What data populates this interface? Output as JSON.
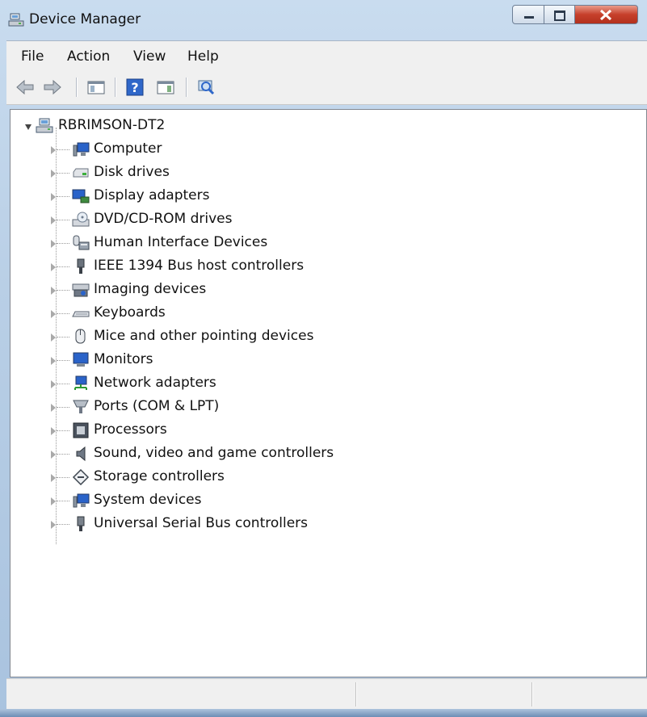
{
  "window": {
    "title": "Device Manager",
    "buttons": [
      "minimize",
      "maximize",
      "close"
    ]
  },
  "menu": {
    "items": [
      "File",
      "Action",
      "View",
      "Help"
    ]
  },
  "toolbar": {
    "buttons": [
      "back-icon",
      "forward-icon",
      "show-hide-console-tree-icon",
      "help-icon",
      "show-hide-action-pane-icon",
      "scan-hardware-icon"
    ]
  },
  "tree": {
    "root": {
      "label": "RBRIMSON-DT2",
      "icon": "computer-network-icon",
      "expanded": true
    },
    "items": [
      {
        "label": "Computer",
        "icon": "computer-icon"
      },
      {
        "label": "Disk drives",
        "icon": "disk-drive-icon"
      },
      {
        "label": "Display adapters",
        "icon": "display-adapter-icon"
      },
      {
        "label": "DVD/CD-ROM drives",
        "icon": "dvd-drive-icon"
      },
      {
        "label": "Human Interface Devices",
        "icon": "hid-icon"
      },
      {
        "label": "IEEE 1394 Bus host controllers",
        "icon": "ieee1394-icon"
      },
      {
        "label": "Imaging devices",
        "icon": "camera-icon"
      },
      {
        "label": "Keyboards",
        "icon": "keyboard-icon"
      },
      {
        "label": "Mice and other pointing devices",
        "icon": "mouse-icon"
      },
      {
        "label": "Monitors",
        "icon": "monitor-icon"
      },
      {
        "label": "Network adapters",
        "icon": "network-adapter-icon"
      },
      {
        "label": "Ports (COM & LPT)",
        "icon": "port-icon"
      },
      {
        "label": "Processors",
        "icon": "processor-icon"
      },
      {
        "label": "Sound, video and game controllers",
        "icon": "speaker-icon"
      },
      {
        "label": "Storage controllers",
        "icon": "storage-controller-icon"
      },
      {
        "label": "System devices",
        "icon": "system-devices-icon"
      },
      {
        "label": "Universal Serial Bus controllers",
        "icon": "usb-icon"
      }
    ]
  },
  "statusbar": {
    "panels": [
      "",
      "",
      ""
    ]
  }
}
